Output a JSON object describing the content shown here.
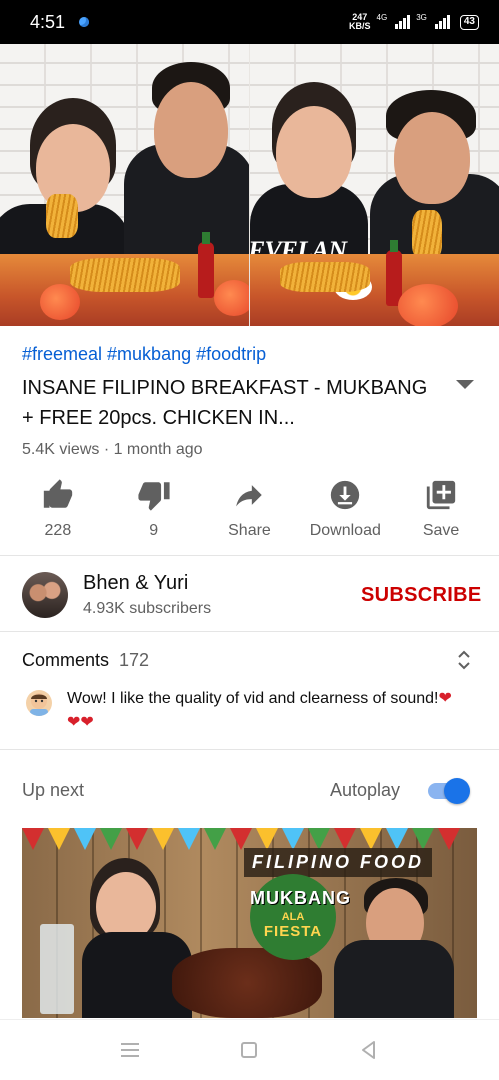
{
  "status_bar": {
    "time": "4:51",
    "net_speed_value": "247",
    "net_speed_unit": "KB/S",
    "sim1_label": "4G",
    "sim2_label": "3G",
    "battery": "43"
  },
  "video": {
    "shirt_text": "EVELAN"
  },
  "hashtags": "#freemeal #mukbang #foodtrip",
  "title": "INSANE FILIPINO BREAKFAST - MUKBANG + FREE 20pcs. CHICKEN IN...",
  "meta_line": "5.4K views · 1 month ago",
  "actions": {
    "like": "228",
    "dislike": "9",
    "share": "Share",
    "download": "Download",
    "save": "Save"
  },
  "channel": {
    "name": "Bhen & Yuri",
    "subscribers": "4.93K subscribers",
    "subscribe_label": "SUBSCRIBE"
  },
  "comments": {
    "label": "Comments",
    "count": "172",
    "top_comment": "Wow! I like the quality of vid and clearness of sound!"
  },
  "up_next": {
    "label": "Up next",
    "autoplay_label": "Autoplay",
    "autoplay_on": true,
    "thumbnail": {
      "banner": "FILIPINO FOOD",
      "circle_line1": "MUKBANG",
      "circle_line2": "ALA",
      "circle_line3": "FIESTA"
    }
  },
  "colors": {
    "link_blue": "#065fd4",
    "subscribe_red": "#cc0000",
    "toggle_blue": "#1a73e8"
  }
}
